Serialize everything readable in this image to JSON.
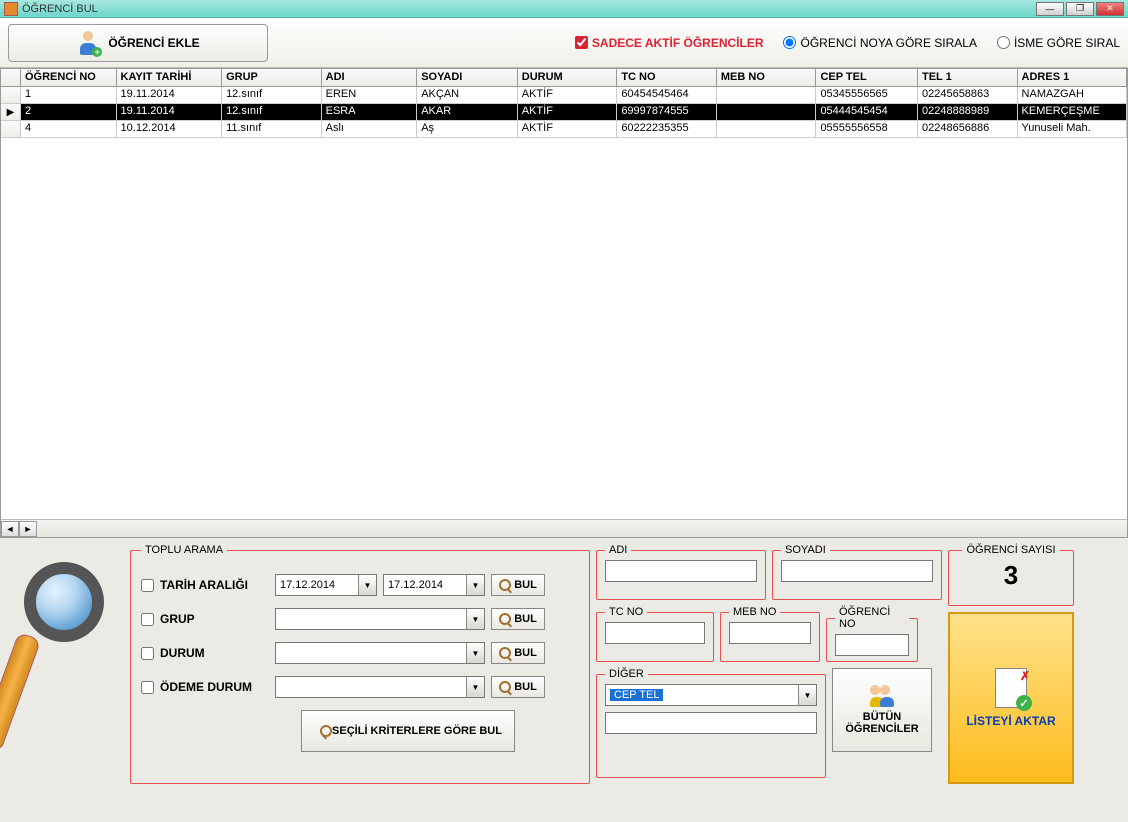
{
  "window": {
    "title": "ÖĞRENCİ BUL"
  },
  "toolbar": {
    "add_student": "ÖĞRENCİ EKLE",
    "only_active": "SADECE AKTİF ÖĞRENCİLER",
    "sort_by_no": "ÖĞRENCİ NOYA GÖRE SIRALA",
    "sort_by_name": "İSME GÖRE SIRAL"
  },
  "grid": {
    "columns": [
      "ÖĞRENCİ NO",
      "KAYIT TARİHİ",
      "GRUP",
      "ADI",
      "SOYADI",
      "DURUM",
      "TC NO",
      "MEB NO",
      "CEP TEL",
      "TEL 1",
      "ADRES 1"
    ],
    "rows": [
      {
        "sel": false,
        "cells": [
          "1",
          "19.11.2014",
          "12.sınıf",
          "EREN",
          "AKÇAN",
          "AKTİF",
          "60454545464",
          "",
          "05345556565",
          "02245658863",
          "NAMAZGAH"
        ]
      },
      {
        "sel": true,
        "cells": [
          "2",
          "19.11.2014",
          "12.sınıf",
          "ESRA",
          "AKAR",
          "AKTİF",
          "69997874555",
          "",
          "05444545454",
          "02248888989",
          "KEMERÇEŞME"
        ]
      },
      {
        "sel": false,
        "cells": [
          "4",
          "10.12.2014",
          "11.sınıf",
          "Aslı",
          "Aş",
          "AKTİF",
          "60222235355",
          "",
          "05555556558",
          "02248656886",
          "Yunuseli Mah."
        ]
      }
    ]
  },
  "search": {
    "legend": "TOPLU ARAMA",
    "date_range": "TARİH ARALIĞI",
    "date_from": "17.12.2014",
    "date_to": "17.12.2014",
    "group": "GRUP",
    "status": "DURUM",
    "payment": "ÖDEME DURUM",
    "find": "BUL",
    "criteria_find": "SEÇİLİ KRİTERLERE GÖRE BUL"
  },
  "filters": {
    "adi": "ADI",
    "soyadi": "SOYADI",
    "tcno": "TC NO",
    "mebno": "MEB NO",
    "ogrno": "ÖĞRENCİ NO",
    "diger": "DİĞER",
    "diger_selected": "CEP TEL"
  },
  "buttons": {
    "all_students": "BÜTÜN ÖĞRENCİLER",
    "export": "LİSTEYİ AKTAR"
  },
  "count": {
    "legend": "ÖĞRENCİ SAYISI",
    "value": "3"
  }
}
